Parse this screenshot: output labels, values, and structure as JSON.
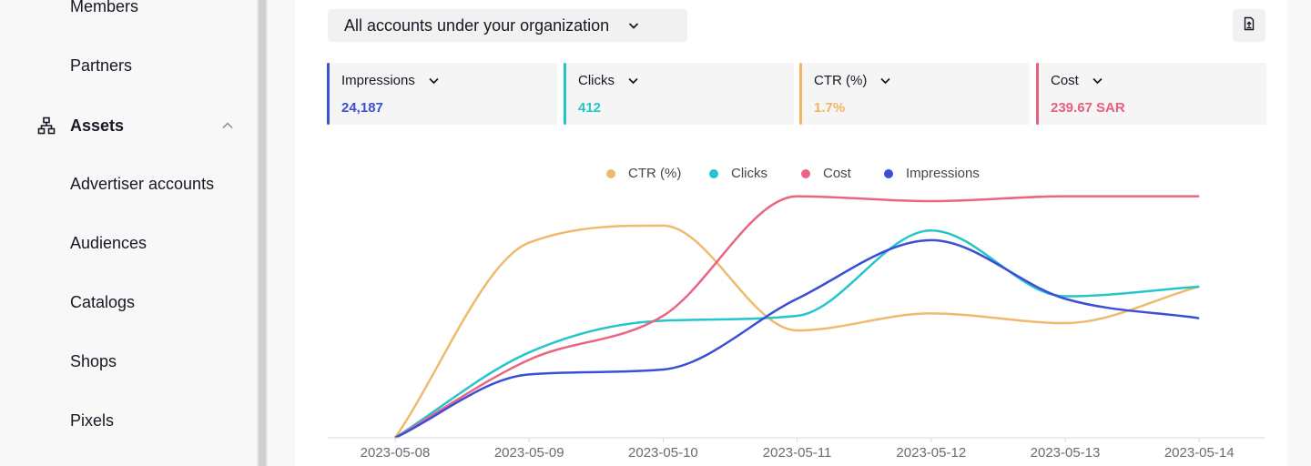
{
  "sidebar": {
    "items": [
      {
        "label": "Members"
      },
      {
        "label": "Partners"
      },
      {
        "label": "Advertiser accounts"
      },
      {
        "label": "Audiences"
      },
      {
        "label": "Catalogs"
      },
      {
        "label": "Shops"
      },
      {
        "label": "Pixels"
      }
    ],
    "group": {
      "label": "Assets",
      "icon": "hierarchy-icon",
      "expanded": true
    }
  },
  "header": {
    "account_selector": "All accounts under your organization",
    "export_icon": "export-file-icon"
  },
  "metrics": [
    {
      "name": "Impressions",
      "value": "24,187",
      "color": "#3b4fd0"
    },
    {
      "name": "Clicks",
      "value": "412",
      "color": "#25c5cc"
    },
    {
      "name": "CTR (%)",
      "value": "1.7%",
      "color": "#f5b462"
    },
    {
      "name": "Cost",
      "value": "239.67 SAR",
      "color": "#ea5e7d"
    }
  ],
  "chart_data": {
    "type": "line",
    "categories": [
      "2023-05-08",
      "2023-05-09",
      "2023-05-10",
      "2023-05-11",
      "2023-05-12",
      "2023-05-13",
      "2023-05-14"
    ],
    "series": [
      {
        "name": "CTR (%)",
        "color": "#f0ba6e",
        "values": [
          0,
          0.8,
          0.87,
          0.44,
          0.51,
          0.47,
          0.62
        ]
      },
      {
        "name": "Clicks",
        "color": "#25c5cc",
        "values": [
          0,
          0.35,
          0.48,
          0.5,
          0.85,
          0.58,
          0.62
        ]
      },
      {
        "name": "Cost",
        "color": "#ea6583",
        "values": [
          0,
          0.32,
          0.5,
          0.99,
          0.97,
          0.99,
          0.99
        ]
      },
      {
        "name": "Impressions",
        "color": "#3a4fd6",
        "values": [
          0,
          0.26,
          0.28,
          0.57,
          0.81,
          0.57,
          0.49
        ]
      }
    ],
    "ylim": [
      0,
      1
    ],
    "legend": "top-center",
    "grid": false
  }
}
